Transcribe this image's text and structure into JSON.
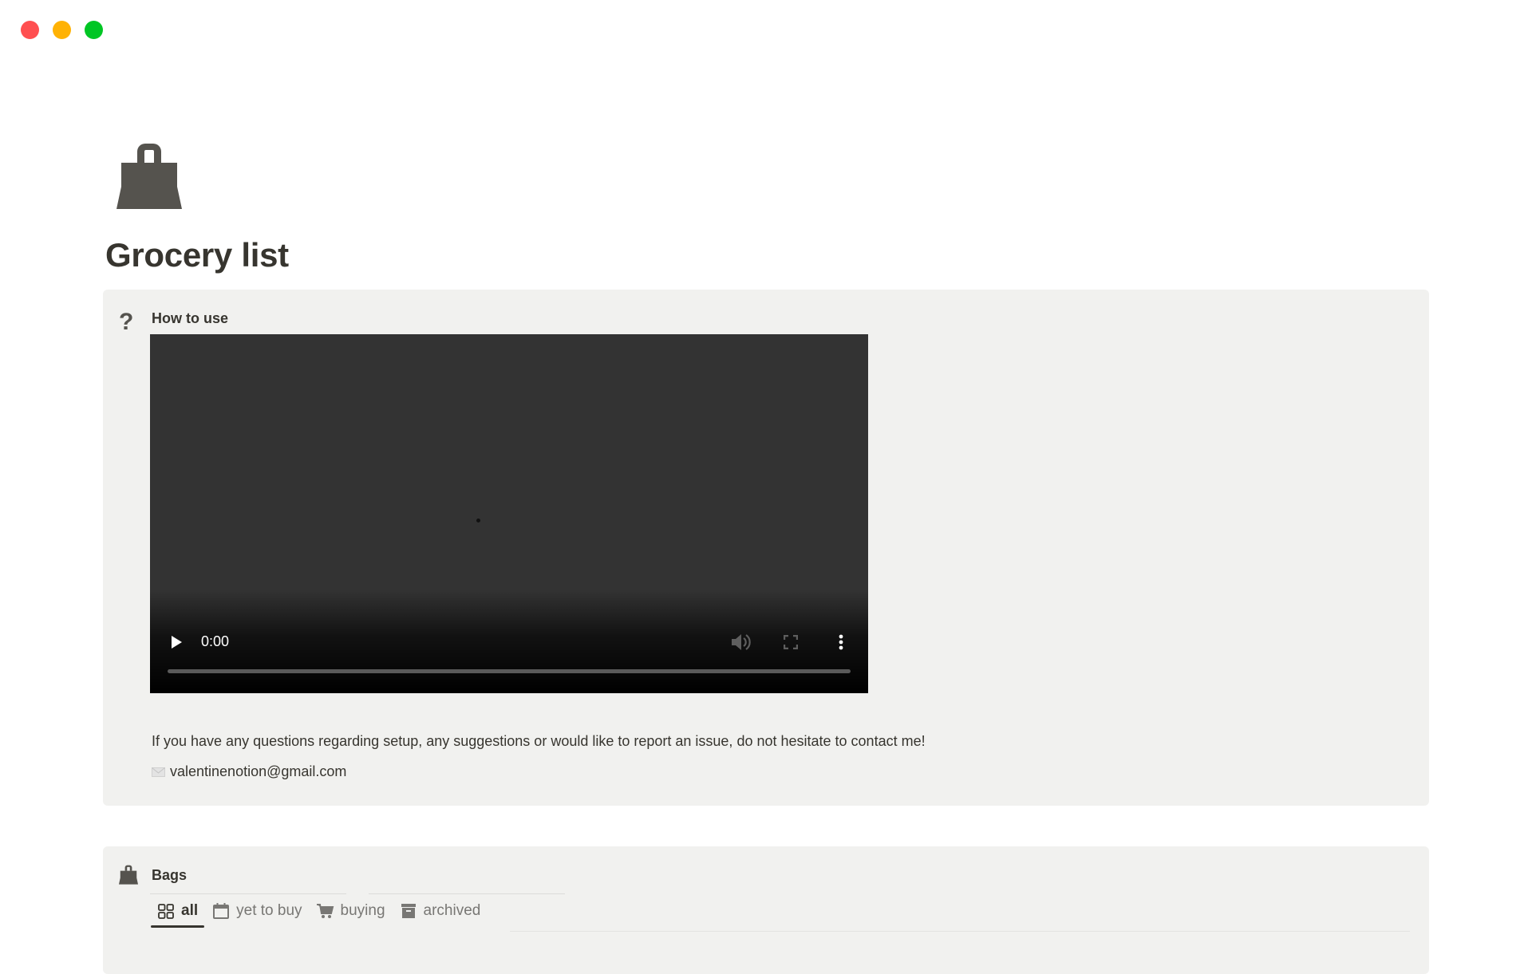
{
  "window": {
    "controls": [
      "close",
      "minimize",
      "maximize"
    ],
    "colors": {
      "close": "#ff4f50",
      "minimize": "#ffb204",
      "maximize": "#00c624"
    }
  },
  "page": {
    "icon": "shopping-bag-icon",
    "title": "Grocery list"
  },
  "how_to_use": {
    "icon": "question-mark-icon",
    "icon_glyph": "?",
    "title": "How to use",
    "video": {
      "current_time": "0:00",
      "progress_percent": 0,
      "controls": [
        "play-icon",
        "volume-icon",
        "fullscreen-icon",
        "more-options-icon"
      ]
    },
    "contact_text": "If you have any questions regarding setup, any suggestions or would like to report an issue, do not hesitate to contact me!",
    "email_icon": "envelope-icon",
    "email": "valentinenotion@gmail.com"
  },
  "bags": {
    "icon": "shopping-bag-icon",
    "title": "Bags",
    "tabs": [
      {
        "label": "all",
        "icon": "gallery-grid-icon",
        "active": true
      },
      {
        "label": "yet to buy",
        "icon": "calendar-icon",
        "active": false
      },
      {
        "label": "buying",
        "icon": "shopping-cart-icon",
        "active": false
      },
      {
        "label": "archived",
        "icon": "archive-box-icon",
        "active": false
      }
    ]
  }
}
